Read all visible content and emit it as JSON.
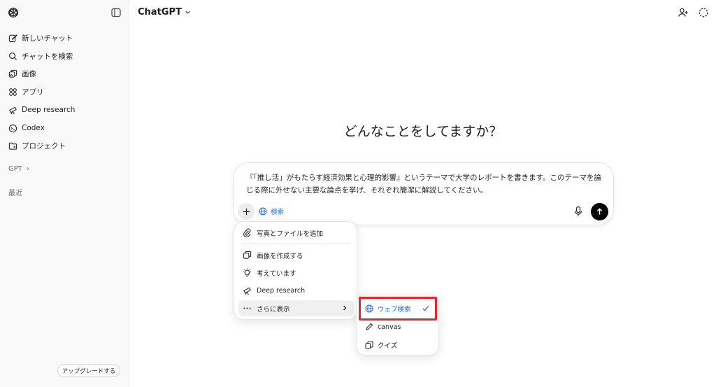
{
  "sidebar": {
    "items": [
      {
        "label": "新しいチャット",
        "icon": "edit-icon"
      },
      {
        "label": "チャットを検索",
        "icon": "search-icon"
      },
      {
        "label": "画像",
        "icon": "images-icon"
      },
      {
        "label": "アプリ",
        "icon": "apps-icon"
      },
      {
        "label": "Deep research",
        "icon": "telescope-icon"
      },
      {
        "label": "Codex",
        "icon": "codex-icon"
      },
      {
        "label": "プロジェクト",
        "icon": "folder-icon"
      }
    ],
    "gpt_label": "GPT",
    "recent_label": "最近",
    "upgrade_label": "アップグレードする"
  },
  "header": {
    "model_name": "ChatGPT"
  },
  "main": {
    "headline": "どんなことをしてますか？",
    "prompt_text": "『「推し活」がもたらす経済効果と心理的影響』というテーマで大学のレポートを書きます。このテーマを論じる際に外せない主要な論点を挙げ、それぞれ簡潔に解説してください。",
    "search_chip": "検索"
  },
  "menu": {
    "items": [
      {
        "label": "写真とファイルを追加",
        "icon": "paperclip-icon"
      },
      {
        "label": "画像を作成する",
        "icon": "image-create-icon"
      },
      {
        "label": "考えています",
        "icon": "lightbulb-icon"
      },
      {
        "label": "Deep research",
        "icon": "telescope-icon"
      },
      {
        "label": "さらに表示",
        "icon": "more-icon"
      }
    ]
  },
  "submenu": {
    "items": [
      {
        "label": "ウェブ検索",
        "icon": "globe-icon",
        "selected": true
      },
      {
        "label": "canvas",
        "icon": "pen-icon"
      },
      {
        "label": "クイズ",
        "icon": "cards-icon"
      }
    ]
  },
  "colors": {
    "accent": "#2b73d8",
    "highlight_border": "#e8242d"
  }
}
